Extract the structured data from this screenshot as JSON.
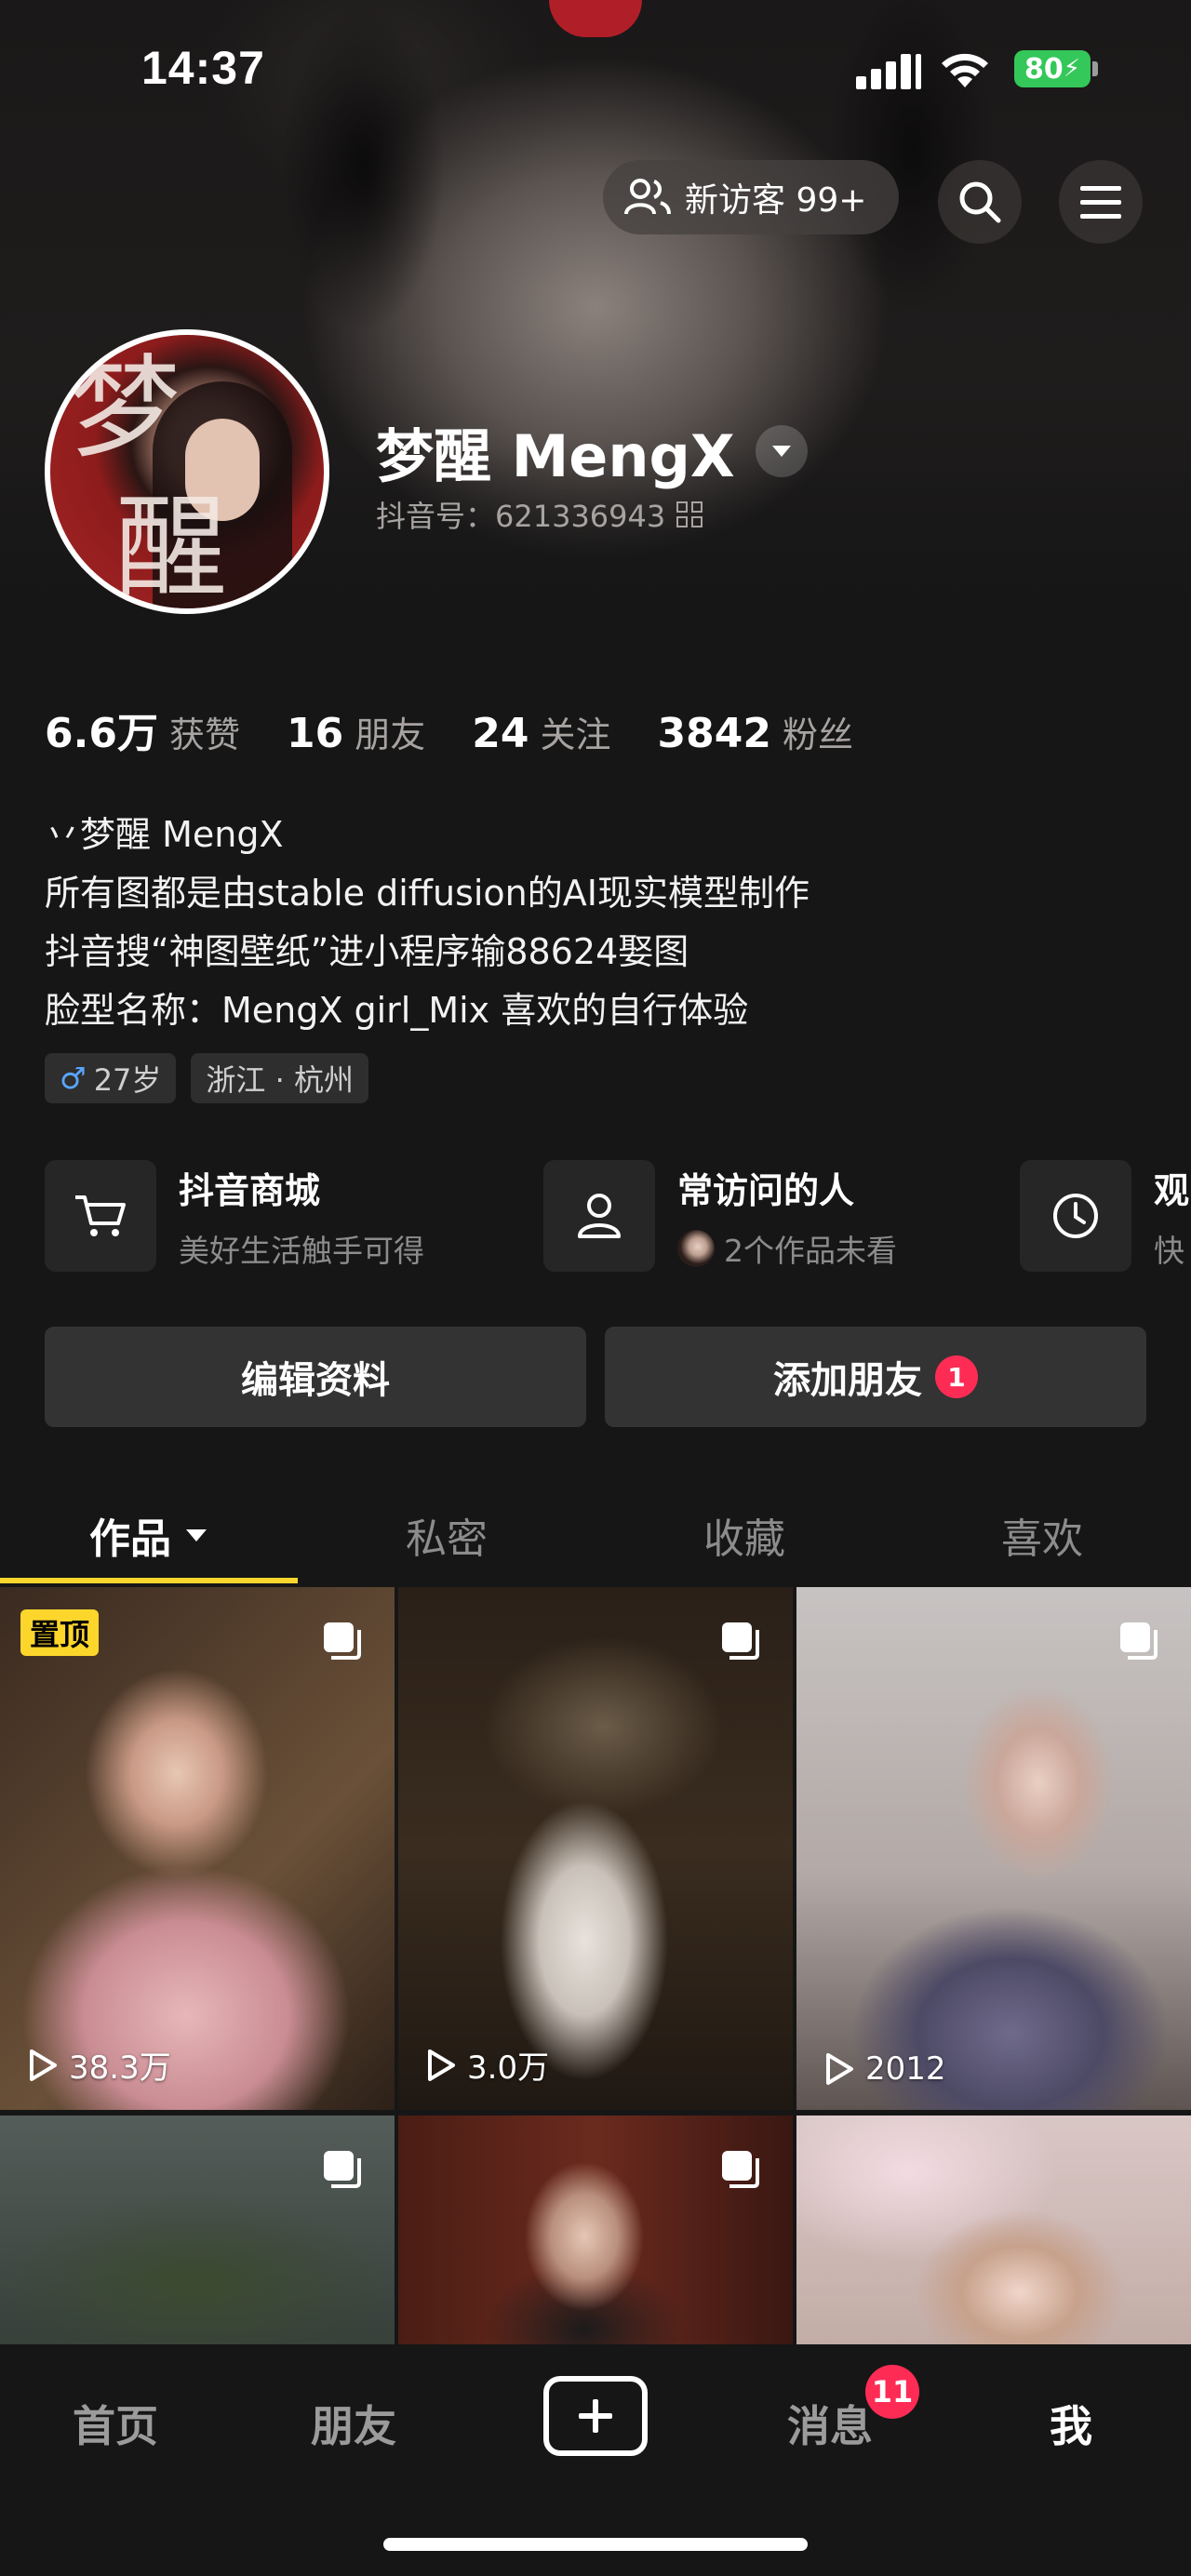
{
  "status_bar": {
    "time": "14:37",
    "battery": "80"
  },
  "header": {
    "visitors_label": "新访客 99+"
  },
  "profile": {
    "name": "梦醒 MengX",
    "douyin_id": "抖音号：621336943"
  },
  "stats": [
    {
      "value": "6.6万",
      "label": "获赞"
    },
    {
      "value": "16",
      "label": "朋友"
    },
    {
      "value": "24",
      "label": "关注"
    },
    {
      "value": "3842",
      "label": "粉丝"
    }
  ],
  "bio": [
    "丷梦醒  MengX",
    "所有图都是由stable diffusion的AI现实模型制作",
    "抖音搜“神图壁纸”进小程序输88624娶图",
    "脸型名称：MengX girl_Mix 喜欢的自行体验"
  ],
  "tags": {
    "age": "27岁",
    "location": "浙江 · 杭州",
    "gender_symbol": "♂"
  },
  "shortcuts": [
    {
      "title": "抖音商城",
      "subtitle": "美好生活触手可得",
      "icon": "cart-icon"
    },
    {
      "title": "常访问的人",
      "subtitle": "2个作品未看",
      "icon": "person-icon"
    },
    {
      "title": "观",
      "subtitle": "快",
      "icon": "clock-icon"
    }
  ],
  "buttons": {
    "edit": "编辑资料",
    "add_friend": "添加朋友",
    "add_friend_badge": "1"
  },
  "tabs": [
    "作品",
    "私密",
    "收藏",
    "喜欢"
  ],
  "grid": [
    {
      "pinned": "置顶",
      "plays": "38.3万"
    },
    {
      "plays": "3.0万"
    },
    {
      "plays": "2012"
    },
    {
      "plays": ""
    },
    {
      "plays": ""
    },
    {
      "plays": ""
    }
  ],
  "bottom_nav": {
    "home": "首页",
    "friends": "朋友",
    "messages": "消息",
    "messages_badge": "11",
    "me": "我"
  },
  "colors": {
    "accent_yellow": "#fdd62c",
    "badge_red": "#fe2c55",
    "battery_green": "#34c759"
  }
}
